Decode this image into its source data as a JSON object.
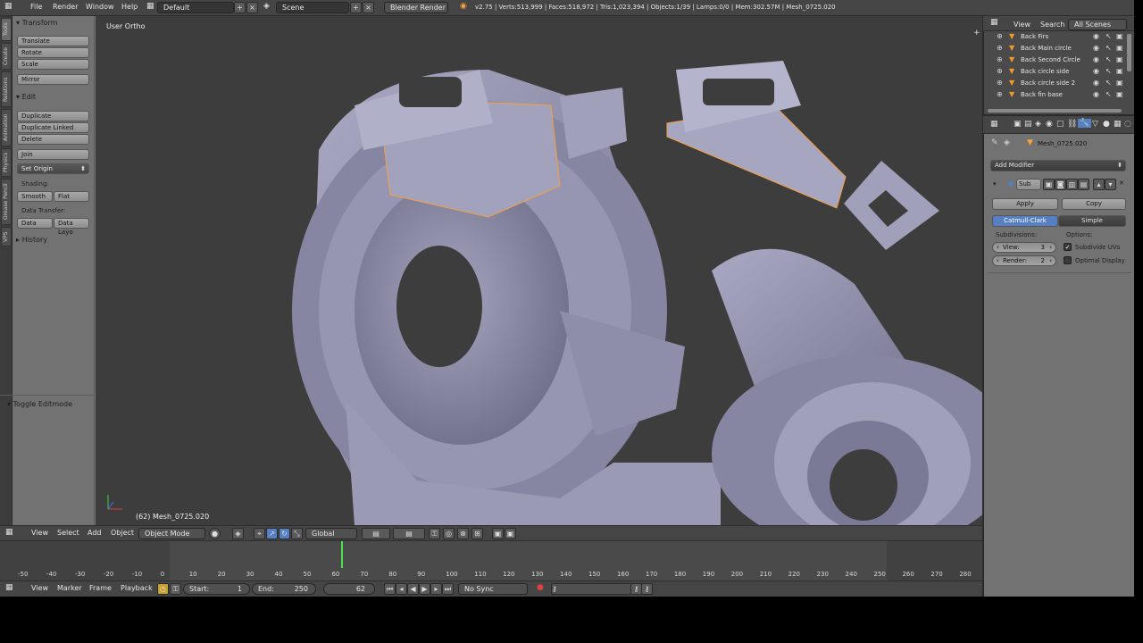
{
  "topbar": {
    "menus": [
      "File",
      "Render",
      "Window",
      "Help"
    ],
    "screen_layout": "Default",
    "scene": "Scene",
    "render_engine": "Blender Render",
    "stats": "v2.75 | Verts:513,999 | Faces:518,972 | Tris:1,023,394 | Objects:1/39 | Lamps:0/0 | Mem:302.57M | Mesh_0725.020"
  },
  "vtabs": [
    "Tools",
    "Create",
    "Relations",
    "Animation",
    "Physics",
    "Grease Pencil",
    "VPS"
  ],
  "toolshelf": {
    "transform_title": "Transform",
    "translate": "Translate",
    "rotate": "Rotate",
    "scale": "Scale",
    "mirror": "Mirror",
    "edit_title": "Edit",
    "duplicate": "Duplicate",
    "duplicate_linked": "Duplicate Linked",
    "delete": "Delete",
    "join": "Join",
    "set_origin": "Set Origin",
    "shading_label": "Shading:",
    "smooth": "Smooth",
    "flat": "Flat",
    "data_transfer_label": "Data Transfer:",
    "data": "Data",
    "data_layout": "Data Layo",
    "history": "History",
    "toggle_editmode": "Toggle Editmode"
  },
  "viewport": {
    "view_label": "User Ortho",
    "object_label": "(62) Mesh_0725.020"
  },
  "vpheader": {
    "view": "View",
    "select": "Select",
    "add": "Add",
    "object": "Object",
    "mode": "Object Mode",
    "orientation": "Global"
  },
  "timeline": {
    "ticks": [
      "-50",
      "-40",
      "-30",
      "-20",
      "-10",
      "0",
      "10",
      "20",
      "30",
      "40",
      "50",
      "60",
      "70",
      "80",
      "90",
      "100",
      "110",
      "120",
      "130",
      "140",
      "150",
      "160",
      "170",
      "180",
      "190",
      "200",
      "210",
      "220",
      "230",
      "240",
      "250",
      "260",
      "270",
      "280"
    ],
    "current_frame": 62
  },
  "tlheader": {
    "view": "View",
    "marker": "Marker",
    "frame": "Frame",
    "playback": "Playback",
    "start_label": "Start:",
    "start_value": "1",
    "end_label": "End:",
    "end_value": "250",
    "current": "62",
    "sync": "No Sync"
  },
  "outliner": {
    "tabs": [
      "View",
      "Search",
      "All Scenes"
    ],
    "rows": [
      "Back Firs",
      "Back Main circle",
      "Back Second Circle",
      "Back circle side",
      "Back circle side 2",
      "Back fin base"
    ]
  },
  "properties": {
    "object_name": "Mesh_0725.020",
    "add_modifier": "Add Modifier",
    "modifier_name": "Sub",
    "apply": "Apply",
    "copy": "Copy",
    "catmull": "Catmull-Clark",
    "simple": "Simple",
    "subdivisions_label": "Subdivisions:",
    "options_label": "Options:",
    "view_label": "View:",
    "view_value": "3",
    "render_label": "Render:",
    "render_value": "2",
    "subdivide_uvs": "Subdivide UVs",
    "optimal_display": "Optimal Display"
  },
  "colors": {
    "accent_blue": "#5680c2",
    "selection_outline": "#f5a040",
    "playhead": "#4ce04c",
    "mesh": "#8a8aa6"
  }
}
